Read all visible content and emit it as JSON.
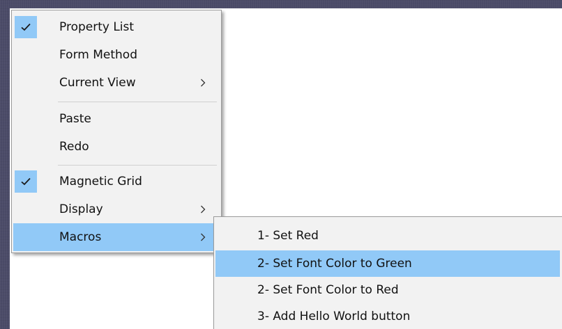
{
  "context_menu": {
    "items": [
      {
        "label": "Property List",
        "checked": true,
        "has_submenu": false
      },
      {
        "label": "Form Method",
        "checked": false,
        "has_submenu": false
      },
      {
        "label": "Current View",
        "checked": false,
        "has_submenu": true
      },
      {
        "label": "Paste",
        "checked": false,
        "has_submenu": false
      },
      {
        "label": "Redo",
        "checked": false,
        "has_submenu": false
      },
      {
        "label": "Magnetic Grid",
        "checked": true,
        "has_submenu": false
      },
      {
        "label": "Display",
        "checked": false,
        "has_submenu": true
      },
      {
        "label": "Macros",
        "checked": false,
        "has_submenu": true,
        "highlighted": true
      }
    ]
  },
  "macros_submenu": {
    "items": [
      {
        "label": "1- Set Red"
      },
      {
        "label": "2- Set Font Color to Green",
        "highlighted": true
      },
      {
        "label": "2- Set Font Color to Red"
      },
      {
        "label": "3- Add Hello World button"
      }
    ]
  },
  "icons": {
    "check": "checkmark-icon",
    "arrow": "chevron-right-icon"
  },
  "colors": {
    "highlight": "#91c9f7",
    "menu_background": "#f2f2f2",
    "desktop": "#4b4b68"
  }
}
